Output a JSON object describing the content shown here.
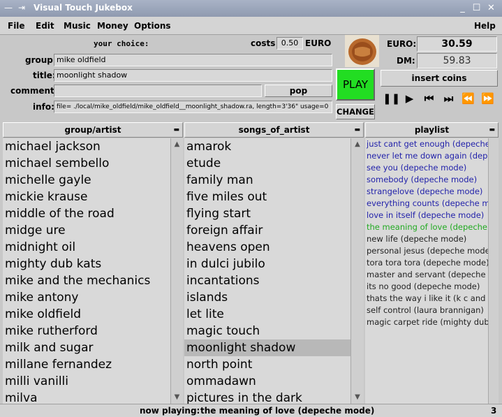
{
  "window": {
    "title": "Visual Touch Jukebox"
  },
  "menu": [
    "File",
    "Edit",
    "Music",
    "Money",
    "Options",
    "Help"
  ],
  "choice": {
    "your_choice_label": "your  choice:",
    "costs_label": "costs",
    "costs_value": "0.50",
    "costs_currency": "EURO",
    "group_label": "group:",
    "group_value": "mike oldfield",
    "title_label": "title:",
    "title_value": "moonlight shadow",
    "comment_label": "comment:",
    "comment_value": "",
    "genre_value": "pop",
    "info_label": "info:",
    "info_value": "file= ./local/mike_oldfield/mike_oldfield__moonlight_shadow.ra, length=3'36\" usage=0"
  },
  "money": {
    "euro_label": "EURO:",
    "euro_value": "30.59",
    "dm_label": "DM:",
    "dm_value": "59.83",
    "insert_coins_label": "insert coins"
  },
  "play_label": "PLAY",
  "change_label": "CHANGE",
  "play_color": "#22dd22",
  "transport": [
    "pause-icon",
    "play-icon",
    "skip-back-icon",
    "skip-forward-icon",
    "rewind-icon",
    "fast-forward-icon"
  ],
  "columns": {
    "artists_header": "group/artist",
    "songs_header": "songs_of_artist",
    "playlist_header": "playlist"
  },
  "artists": [
    "michael jackson",
    "michael sembello",
    "michelle gayle",
    "mickie krause",
    "middle of the road",
    "midge ure",
    "midnight oil",
    "mighty dub kats",
    "mike and the mechanics",
    "mike antony",
    "mike oldfield",
    "mike rutherford",
    "milk and sugar",
    "millane fernandez",
    "milli vanilli",
    "milva"
  ],
  "songs": [
    "amarok",
    "etude",
    "family man",
    "five miles out",
    "flying start",
    "foreign affair",
    "heavens open",
    "in dulci jubilo",
    "incantations",
    "islands",
    "let lite",
    "magic touch",
    "moonlight shadow",
    "north point",
    "ommadawn",
    "pictures in the dark"
  ],
  "selected_song_index": 12,
  "playlist": [
    {
      "text": "just cant get enough (depeche mode)",
      "color": "#2222aa"
    },
    {
      "text": "never let me down again (depeche mode)",
      "color": "#2222aa"
    },
    {
      "text": "see you (depeche mode)",
      "color": "#2222aa"
    },
    {
      "text": "somebody (depeche mode)",
      "color": "#2222aa"
    },
    {
      "text": "strangelove (depeche mode)",
      "color": "#2222aa"
    },
    {
      "text": "everything counts (depeche mode)",
      "color": "#2222aa"
    },
    {
      "text": "love in itself (depeche mode)",
      "color": "#2222aa"
    },
    {
      "text": "the meaning of love (depeche mode)",
      "color": "#22aa22"
    },
    {
      "text": "new life (depeche mode)",
      "color": "#222222"
    },
    {
      "text": "personal jesus (depeche mode)",
      "color": "#222222"
    },
    {
      "text": "tora tora tora (depeche mode)",
      "color": "#222222"
    },
    {
      "text": "master and servant (depeche mode)",
      "color": "#222222"
    },
    {
      "text": "its no good (depeche mode)",
      "color": "#222222"
    },
    {
      "text": "thats the way i like it (k c and the sunshine band)",
      "color": "#222222"
    },
    {
      "text": "self control (laura brannigan)",
      "color": "#222222"
    },
    {
      "text": "magic carpet ride (mighty dub kats)",
      "color": "#222222"
    }
  ],
  "status": {
    "now_playing_label": "now playing:",
    "now_playing_value": "the meaning of love (depeche mode)",
    "count": "3"
  }
}
